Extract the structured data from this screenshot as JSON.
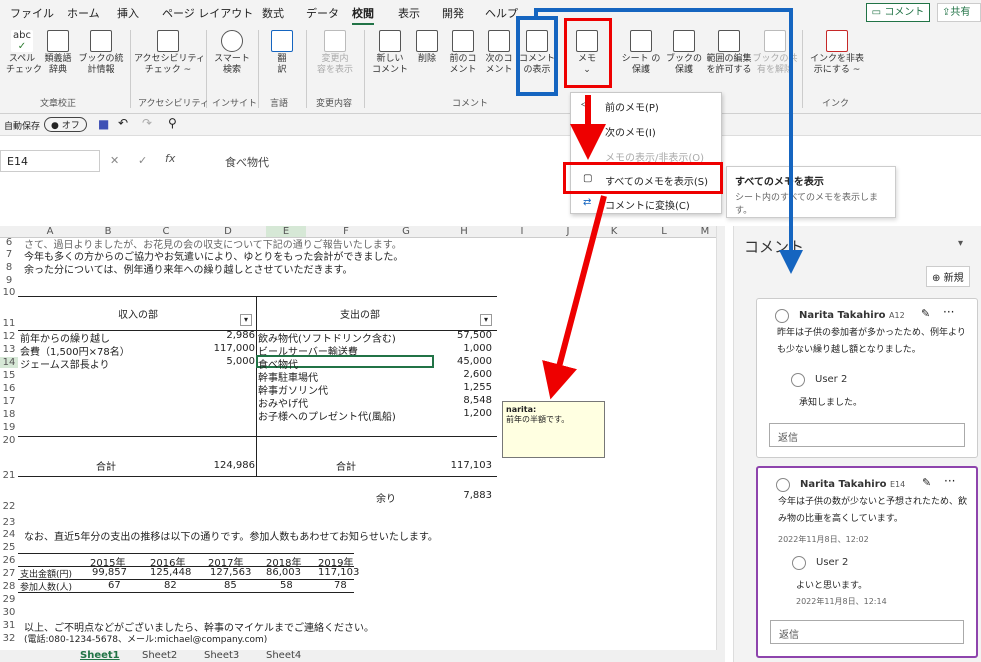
{
  "menu": {
    "items": [
      "ファイル",
      "ホーム",
      "挿入",
      "ページ レイアウト",
      "数式",
      "データ",
      "校閲",
      "表示",
      "開発",
      "ヘルプ"
    ],
    "active": "校閲",
    "comment_btn": "コメント",
    "share_btn": "共有"
  },
  "ribbon": {
    "spell": "スペル\nチェック",
    "synonyms": "類義語\n辞典",
    "workbook_stats": "ブックの統\n計情報",
    "accessibility": "アクセシビリティ\nチェック ~",
    "smart_lookup": "スマート\n検索",
    "translate": "翻\n訳",
    "show_changes": "変更内\n容を表示",
    "new_comment": "新しい\nコメント",
    "delete": "削除",
    "prev_comment": "前のコ\nメント",
    "next_comment": "次のコ\nメント",
    "show_comments": "コメント\nの表示",
    "memo": "メモ",
    "protect_sheet": "シート の\n保護",
    "protect_book": "ブックの\n保護",
    "allow_edit": "範囲の編集\nを許可する",
    "unshare": "ブックの共\n有を解除",
    "hide_ink": "インクを非表\n示にする ~",
    "groups": {
      "proofing": "文章校正",
      "accessibility": "アクセシビリティ",
      "insights": "インサイト",
      "language": "言語",
      "changes": "変更内容",
      "comments": "コメント",
      "ink": "インク"
    }
  },
  "qat": {
    "autosave": "自動保存",
    "toggle": "オフ"
  },
  "namebox": "E14",
  "formula": "食べ物代",
  "dropdown": {
    "items": [
      "前のメモ(P)",
      "次のメモ(I)",
      "メモの表示/非表示(O)",
      "すべてのメモを表示(S)",
      "コメントに変換(C)"
    ]
  },
  "tooltip": {
    "title": "すべてのメモを表示",
    "body": "シート内のすべてのメモを表示しま\nす。"
  },
  "columns": [
    "A",
    "B",
    "C",
    "D",
    "E",
    "F",
    "G",
    "H",
    "I",
    "J",
    "K",
    "L",
    "M"
  ],
  "sheet": {
    "r7": "今年も多くの方からのご協力やお気遣いにより、ゆとりをもった会計ができました。",
    "r8": "余った分については、例年通り来年への繰り越しとさせていただきます。",
    "r6": "さて、過日よりましたが、お花見の会の収支について下記の通りご報告いたします。",
    "income_hdr": "収入の部",
    "expense_hdr": "支出の部",
    "income": [
      {
        "label": "前年からの繰り越し",
        "value": "2,986"
      },
      {
        "label": "会費（1,500円×78名）",
        "value": "117,000"
      },
      {
        "label": "ジェームス部長より",
        "value": "5,000"
      }
    ],
    "expense": [
      {
        "label": "飲み物代(ソフトドリンク含む)",
        "value": "57,500"
      },
      {
        "label": "ビールサーバー輸送費",
        "value": "1,000"
      },
      {
        "label": "食べ物代",
        "value": "45,000"
      },
      {
        "label": "幹事駐車場代",
        "value": "2,600"
      },
      {
        "label": "幹事ガソリン代",
        "value": "1,255"
      },
      {
        "label": "おみやげ代",
        "value": "8,548"
      },
      {
        "label": "お子様へのプレゼント代(風船)",
        "value": "1,200"
      }
    ],
    "total_label": "合計",
    "income_total": "124,986",
    "expense_total": "117,103",
    "remain_label": "余り",
    "remain": "7,883",
    "r24": "なお、直近5年分の支出の推移は以下の通りです。参加人数もあわせてお知らせいたします。",
    "years": [
      "2015年",
      "2016年",
      "2017年",
      "2018年",
      "2019年"
    ],
    "exp_label": "支出金額(円)",
    "exp": [
      "99,857",
      "125,448",
      "127,563",
      "86,003",
      "117,103"
    ],
    "ppl_label": "参加人数(人)",
    "ppl": [
      "67",
      "82",
      "85",
      "58",
      "78"
    ],
    "r31": "以上、ご不明点などがございましたら、幹事のマイケルまでご連絡ください。",
    "r32": "(電話:080-1234-5678、メール:michael@company.com)"
  },
  "note": {
    "author": "narita:",
    "text": "前年の半額です。"
  },
  "comments_pane": {
    "title": "コメント",
    "new_btn": "新規",
    "cards": [
      {
        "author": "Narita Takahiro",
        "ref": "A12",
        "text": "昨年は子供の参加者が多かったため、例年よりも少ない繰り越し額となりました。",
        "reply_author": "User 2",
        "reply_text": "承知しました。",
        "reply_placeholder": "返信"
      },
      {
        "author": "Narita Takahiro",
        "ref": "E14",
        "text": "今年は子供の数が少ないと予想されたため、飲み物の比重を高くしています。",
        "date": "2022年11月8日、12:02",
        "reply_author": "User 2",
        "reply_text": "よいと思います。",
        "reply_date": "2022年11月8日、12:14",
        "reply_placeholder": "返信"
      }
    ]
  },
  "sheet_tabs": [
    "Sheet1",
    "Sheet2",
    "Sheet3",
    "Sheet4"
  ]
}
